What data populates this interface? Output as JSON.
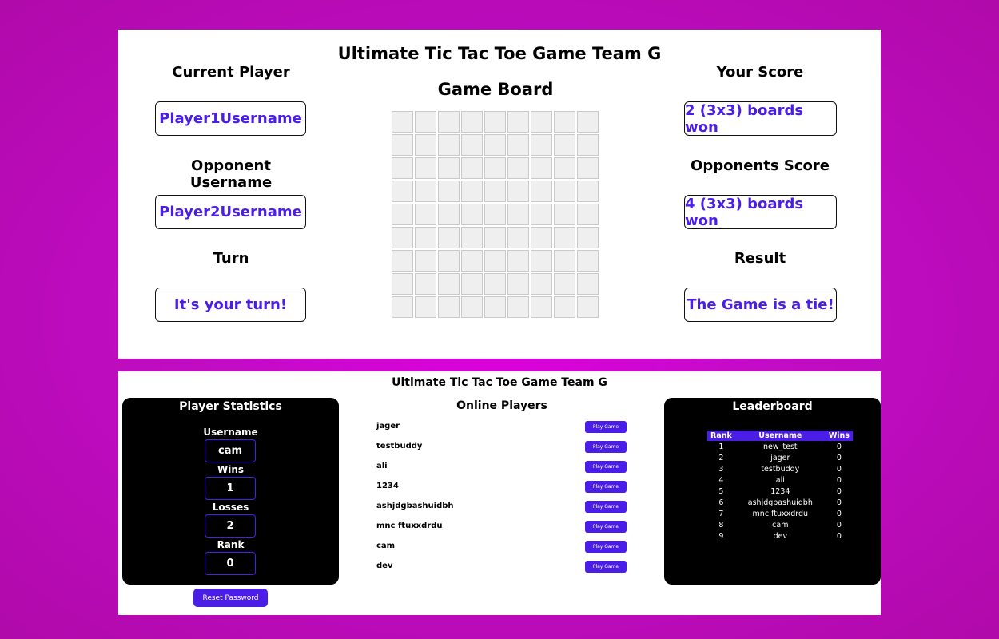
{
  "game": {
    "title": "Ultimate Tic Tac Toe Game Team G",
    "board_title": "Game Board",
    "current_player_label": "Current Player",
    "current_player": "Player1Username",
    "opponent_label": "Opponent Username",
    "opponent": "Player2Username",
    "turn_label": "Turn",
    "turn": "It's your turn!",
    "your_score_label": "Your Score",
    "your_score": "2 (3x3) boards won",
    "opponent_score_label": "Opponents Score",
    "opponent_score": "4 (3x3) boards won",
    "result_label": "Result",
    "result": "The Game is a tie!"
  },
  "lobby": {
    "title": "Ultimate Tic Tac Toe Game Team G",
    "stats": {
      "title": "Player Statistics",
      "username_label": "Username",
      "username": "cam",
      "wins_label": "Wins",
      "wins": "1",
      "losses_label": "Losses",
      "losses": "2",
      "rank_label": "Rank",
      "rank": "0",
      "reset_label": "Reset Password"
    },
    "online": {
      "title": "Online Players",
      "play_label": "Play Game",
      "players": [
        "jager",
        "testbuddy",
        "ali",
        "1234",
        "ashjdgbashuidbh",
        "mnc ftuxxdrdu",
        "cam",
        "dev"
      ]
    },
    "leaderboard": {
      "title": "Leaderboard",
      "headers": [
        "Rank",
        "Username",
        "Wins"
      ],
      "rows": [
        [
          "1",
          "new_test",
          "0"
        ],
        [
          "2",
          "jager",
          "0"
        ],
        [
          "3",
          "testbuddy",
          "0"
        ],
        [
          "4",
          "ali",
          "0"
        ],
        [
          "5",
          "1234",
          "0"
        ],
        [
          "6",
          "ashjdgbashuidbh",
          "0"
        ],
        [
          "7",
          "mnc ftuxxdrdu",
          "0"
        ],
        [
          "8",
          "cam",
          "0"
        ],
        [
          "9",
          "dev",
          "0"
        ]
      ]
    }
  },
  "colors": {
    "accent": "#4a1ee6",
    "background": "#c20cc6",
    "cell": "#efefef"
  }
}
